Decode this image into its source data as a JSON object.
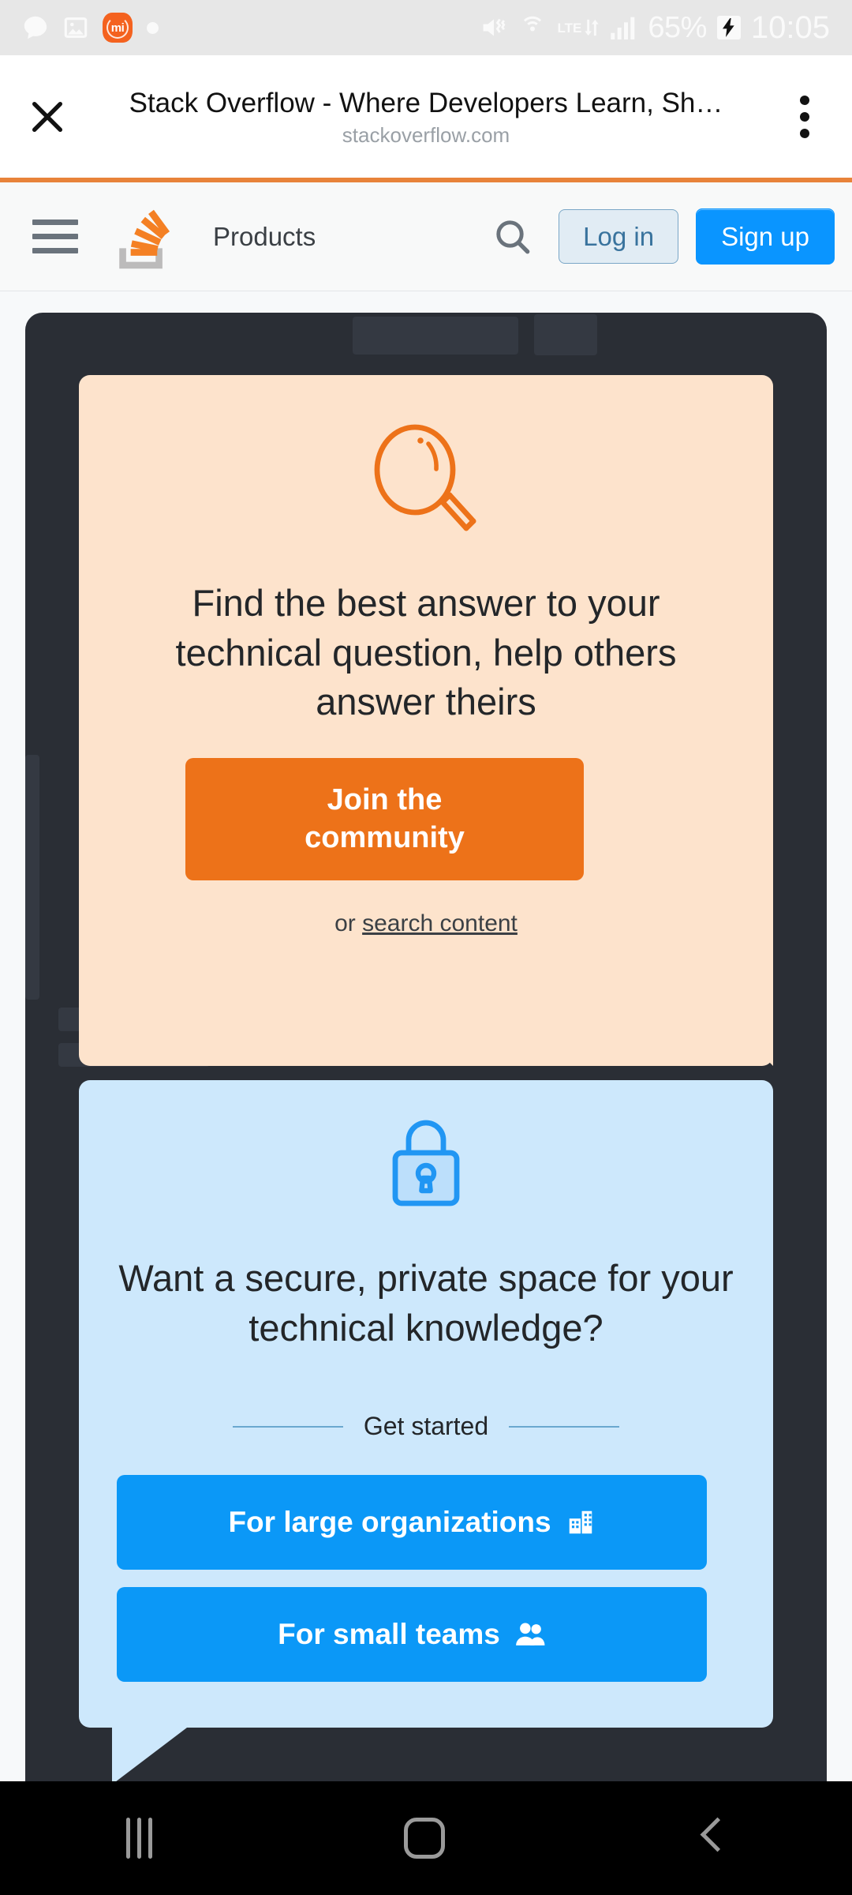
{
  "statusbar": {
    "icons_left": [
      "talk-bubble-icon",
      "gallery-image-icon",
      "mi-app-icon",
      "dot-indicator"
    ],
    "mi_label": "mi",
    "icons_right": [
      "mute-vibrate-icon",
      "hotspot-icon",
      "lte-data-icon",
      "signal-bars-icon",
      "battery-charging-icon"
    ],
    "network_type": "LTE",
    "battery_percent": "65%",
    "time": "10:05"
  },
  "chrome": {
    "close_icon": "close-icon",
    "title": "Stack Overflow - Where Developers Learn, Sh…",
    "url": "stackoverflow.com",
    "menu_icon": "kebab-menu-icon"
  },
  "siteheader": {
    "menu_icon": "hamburger-menu-icon",
    "logo": "stack-overflow-logo",
    "products_label": "Products",
    "search_icon": "search-icon",
    "login_label": "Log in",
    "signup_label": "Sign up"
  },
  "orange_card": {
    "icon": "magnifying-glass-icon",
    "heading": "Find the best answer to your technical question, help others answer theirs",
    "cta_label": "Join the\ncommunity",
    "secondary_prefix": "or ",
    "secondary_link": "search content"
  },
  "blue_card": {
    "icon": "lock-icon",
    "heading": "Want a secure, private space for your technical knowledge?",
    "divider_label": "Get started",
    "buttons": [
      {
        "label": "For large organizations",
        "icon": "building-icon"
      },
      {
        "label": "For small teams",
        "icon": "people-icon"
      }
    ]
  },
  "navbar": {
    "recents_label": "recents-icon",
    "home_label": "home-icon",
    "back_label": "back-icon"
  },
  "colors": {
    "orange_accent": "#ed7219",
    "orange_card_bg": "#fde3cc",
    "blue_accent": "#0b98f7",
    "blue_card_bg": "#cde8fc",
    "dark_panel": "#2a2e35",
    "rule": "#e8833a"
  }
}
